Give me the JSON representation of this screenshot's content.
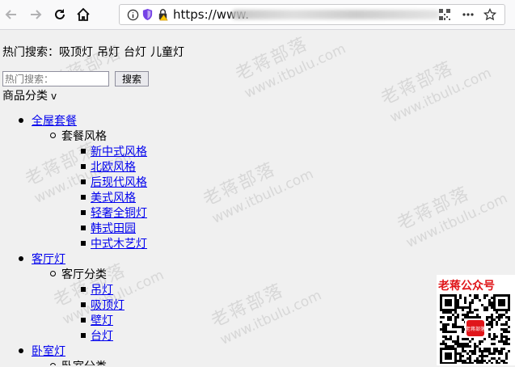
{
  "browser": {
    "url_prefix": "https://www.",
    "icons": [
      "back-icon",
      "forward-icon",
      "reload-icon",
      "home-icon",
      "info-icon",
      "shield-icon",
      "insecure-lock-icon",
      "qr-icon",
      "more-icon",
      "bookmark-star-icon"
    ]
  },
  "hot_search": {
    "label": "热门搜索：",
    "words": [
      "吸顶灯",
      "吊灯",
      "台灯",
      "儿童灯"
    ]
  },
  "search": {
    "placeholder": "热门搜索：",
    "button": "搜索"
  },
  "category": {
    "title": "商品分类",
    "caret": "v",
    "groups": [
      {
        "name": "全屋套餐",
        "sub": "套餐风格",
        "items": [
          "新中式风格",
          "北欧风格",
          "后现代风格",
          "美式风格",
          "轻奢全铜灯",
          "韩式田园",
          "中式木艺灯"
        ]
      },
      {
        "name": "客厅灯",
        "sub": "客厅分类",
        "items": [
          "吊灯",
          "吸顶灯",
          "壁灯",
          "台灯"
        ]
      },
      {
        "name": "卧室灯",
        "sub": "卧室分类",
        "items": []
      }
    ]
  },
  "watermark": {
    "zh": "老蒋部落",
    "en": "www.itbulu.com"
  },
  "qr_card": {
    "title": "老蒋公众号",
    "center_label": "老蒋部落"
  }
}
